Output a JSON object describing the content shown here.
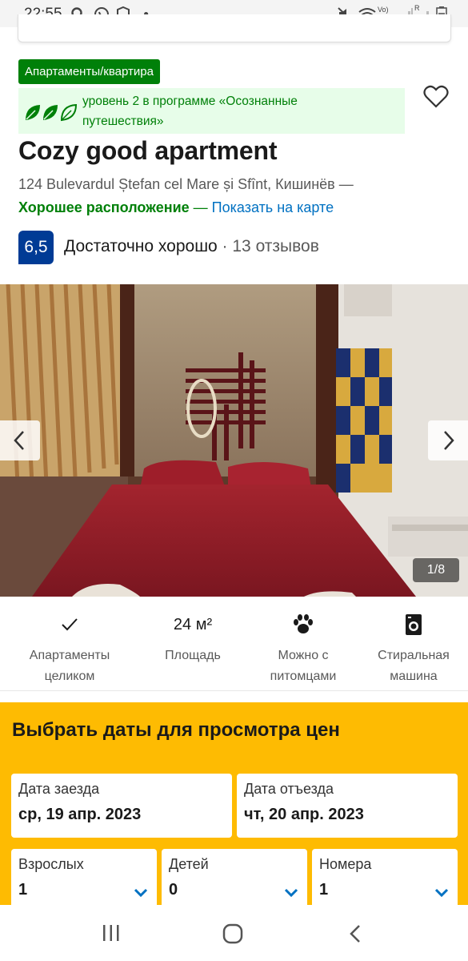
{
  "status_bar": {
    "time": "22:55",
    "left_icons": [
      "search-icon",
      "whatsapp-icon",
      "shield-icon",
      "dot-icon"
    ],
    "right_icons": [
      "mute-icon",
      "wifi-icon",
      "signal-icon",
      "battery-icon"
    ],
    "network_label": "Vo) LTE1",
    "signal_label": "R"
  },
  "property": {
    "type_badge": "Апартаменты/квартира",
    "eco_text": "уровень 2 в программе «Осознанные путешествия»",
    "title": "Cozy good apartment",
    "address": "124 Bulevardul Ștefan cel Mare și Sfînt, Кишинёв —",
    "location_label": "Хорошее расположение",
    "location_dash": " — ",
    "map_link": "Показать на карте",
    "score": "6,5",
    "rating_word": "Достаточно хорошо",
    "reviews": " · 13 отзывов"
  },
  "gallery": {
    "counter": "1/8"
  },
  "facilities": [
    {
      "icon": "checkmark-icon",
      "label": "Апартаменты целиком"
    },
    {
      "icon_text": "24 м²",
      "label": "Площадь"
    },
    {
      "icon": "paw-icon",
      "label": "Можно с питомцами"
    },
    {
      "icon": "washing-machine-icon",
      "label": "Стиральная машина"
    }
  ],
  "dates": {
    "title": "Выбрать даты для просмотра цен",
    "checkin_label": "Дата заезда",
    "checkin_value": "ср, 19 апр. 2023",
    "checkout_label": "Дата отъезда",
    "checkout_value": "чт, 20 апр. 2023",
    "adults_label": "Взрослых",
    "adults_value": "1",
    "children_label": "Детей",
    "children_value": "0",
    "rooms_label": "Номера",
    "rooms_value": "1"
  },
  "colors": {
    "brand_blue": "#003b95",
    "link_blue": "#0071c2",
    "green": "#008009",
    "yellow": "#febb02"
  }
}
